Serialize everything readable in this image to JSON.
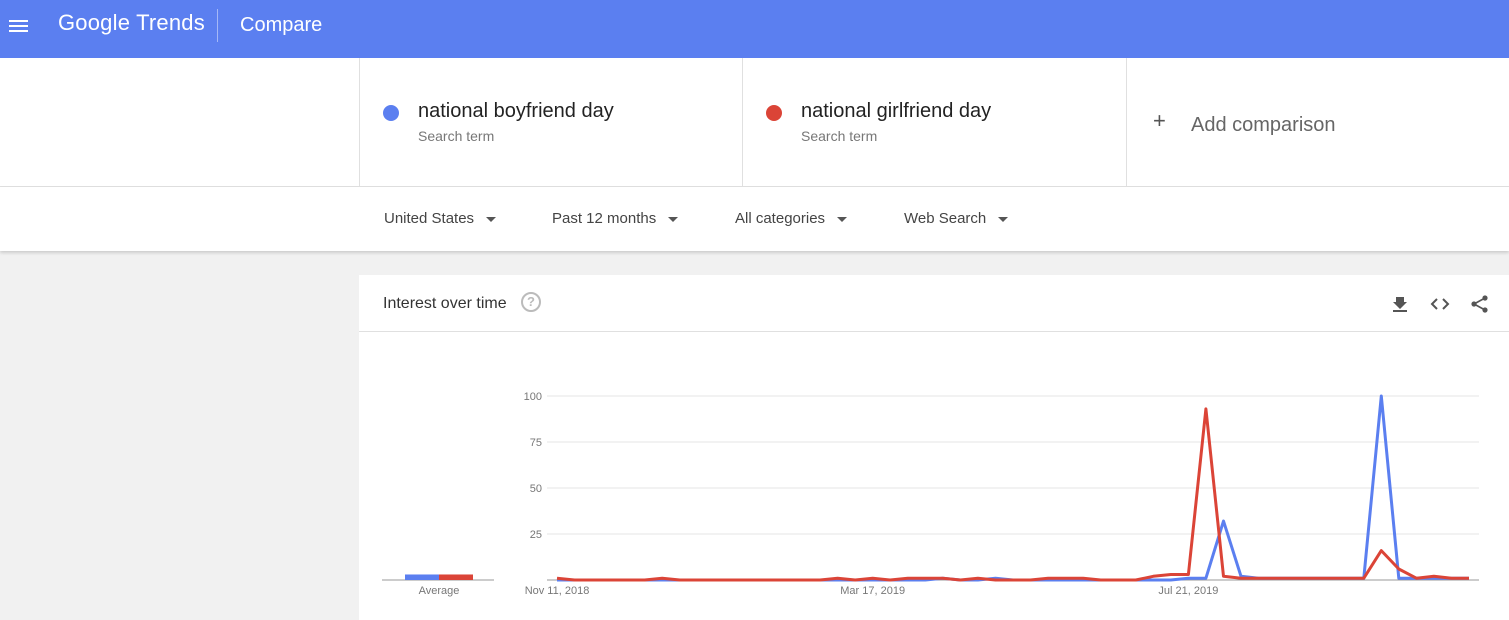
{
  "header": {
    "logo_google": "Google",
    "logo_trends": "Trends",
    "page": "Compare"
  },
  "terms": [
    {
      "name": "national boyfriend day",
      "type": "Search term",
      "color": "#5b7ff0"
    },
    {
      "name": "national girlfriend day",
      "type": "Search term",
      "color": "#db4437"
    }
  ],
  "add_comparison": {
    "plus": "+",
    "label": "Add comparison"
  },
  "filters": {
    "region": "United States",
    "time": "Past 12 months",
    "category": "All categories",
    "search_type": "Web Search"
  },
  "card": {
    "title": "Interest over time",
    "help": "?",
    "icons": [
      "download-icon",
      "embed-icon",
      "share-icon"
    ]
  },
  "chart_data": {
    "type": "line",
    "yticks": [
      25,
      50,
      75,
      100
    ],
    "ylim": [
      0,
      100
    ],
    "xtick_labels": [
      "Nov 11, 2018",
      "Mar 17, 2019",
      "Jul 21, 2019"
    ],
    "xtick_index": [
      0,
      18,
      36
    ],
    "average_label": "Average",
    "averages": [
      3,
      3
    ],
    "series": [
      {
        "name": "national boyfriend day",
        "color": "#5b7ff0",
        "values": [
          0,
          0,
          0,
          0,
          0,
          0,
          0,
          0,
          0,
          0,
          0,
          0,
          0,
          0,
          0,
          0,
          0,
          0,
          0,
          0,
          0,
          0,
          1,
          0,
          0,
          1,
          0,
          0,
          0,
          0,
          0,
          0,
          0,
          0,
          0,
          0,
          1,
          1,
          32,
          2,
          1,
          1,
          1,
          1,
          1,
          1,
          1,
          100,
          1,
          1,
          1,
          1,
          1
        ]
      },
      {
        "name": "national girlfriend day",
        "color": "#db4437",
        "values": [
          1,
          0,
          0,
          0,
          0,
          0,
          1,
          0,
          0,
          0,
          0,
          0,
          0,
          0,
          0,
          0,
          1,
          0,
          1,
          0,
          1,
          1,
          1,
          0,
          1,
          0,
          0,
          0,
          1,
          1,
          1,
          0,
          0,
          0,
          2,
          3,
          3,
          93,
          2,
          1,
          1,
          1,
          1,
          1,
          1,
          1,
          1,
          16,
          6,
          1,
          2,
          1,
          1
        ]
      }
    ]
  }
}
